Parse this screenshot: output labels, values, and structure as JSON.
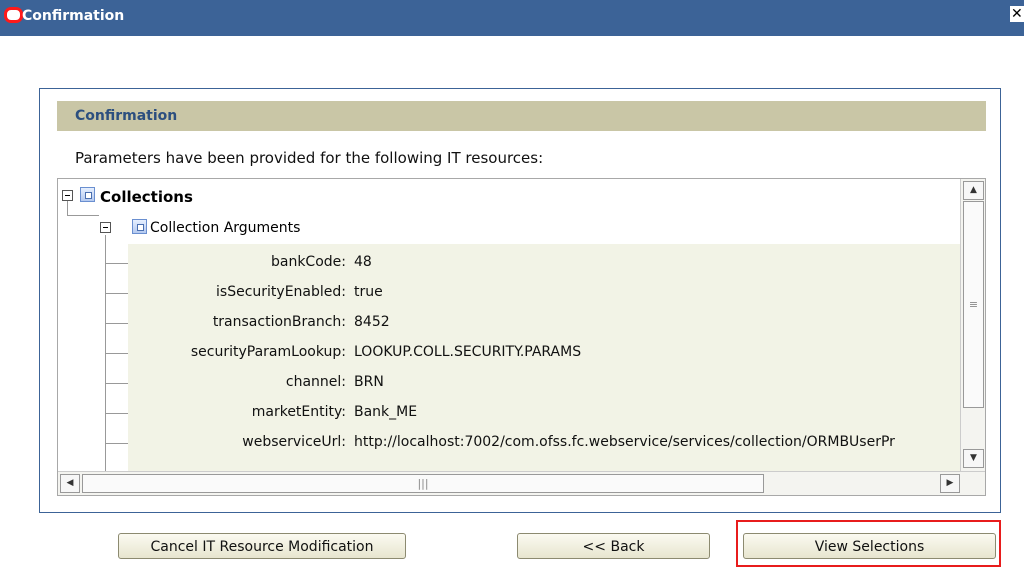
{
  "window": {
    "title": "Confirmation",
    "close_label": "✕"
  },
  "section": {
    "header": "Confirmation",
    "intro": "Parameters have been provided for the following IT resources:"
  },
  "tree": {
    "root": {
      "label": "Collections",
      "icon": "node-icon",
      "expanded": true
    },
    "child": {
      "label": "Collection Arguments",
      "icon": "node-icon",
      "expanded": true
    },
    "parameters": [
      {
        "key": "bankCode:",
        "value": "48"
      },
      {
        "key": "isSecurityEnabled:",
        "value": "true"
      },
      {
        "key": "transactionBranch:",
        "value": "8452"
      },
      {
        "key": "securityParamLookup:",
        "value": "LOOKUP.COLL.SECURITY.PARAMS"
      },
      {
        "key": "channel:",
        "value": "BRN"
      },
      {
        "key": "marketEntity:",
        "value": "Bank_ME"
      },
      {
        "key": "webserviceUrl:",
        "value": "http://localhost:7002/com.ofss.fc.webservice/services/collection/ORMBUserPr"
      }
    ]
  },
  "scrollbars": {
    "up": "▲",
    "down": "▼",
    "left": "◀",
    "right": "▶",
    "vthumb_grip": "≡",
    "hthumb_grip": "|||"
  },
  "buttons": {
    "cancel": "Cancel IT Resource Modification",
    "back": "<< Back",
    "view": "View Selections"
  },
  "colors": {
    "titlebar": "#3c6397",
    "section_header": "#c9c6a6",
    "highlight": "#e81c1c"
  }
}
